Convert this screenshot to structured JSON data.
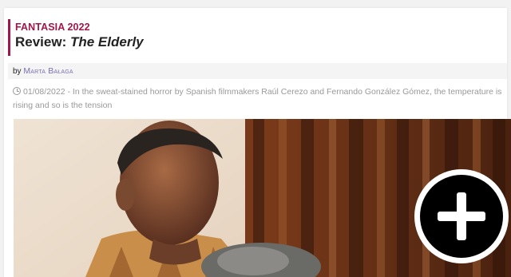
{
  "article": {
    "category": "FANTASIA 2022",
    "title_prefix": "Review: ",
    "title_film": "The Elderly",
    "byline_prefix": "by ",
    "author": "Marta Bałaga",
    "date": "01/08/2022",
    "summary_separator": " - ",
    "summary": "In the sweat-stained horror by Spanish filmmakers Raúl Cerezo and Fernando González Gómez, the temperature is rising and so is the tension"
  },
  "image": {
    "icon": "zoom-plus-icon"
  },
  "colors": {
    "accent": "#a0174b",
    "author_link": "#7a6fb0",
    "muted_text": "#999999",
    "byline_bg": "#f4f4f4"
  }
}
